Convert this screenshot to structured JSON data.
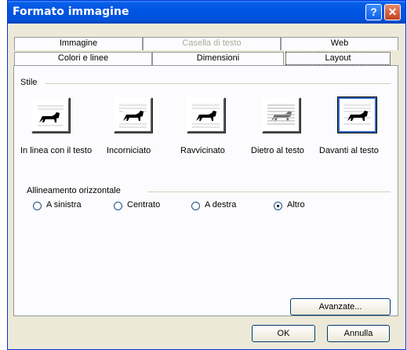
{
  "window": {
    "title": "Formato immagine"
  },
  "titlebar": {
    "help_glyph": "?",
    "close_glyph": "✕"
  },
  "tabs_row1": [
    {
      "label": "Immagine",
      "enabled": true
    },
    {
      "label": "Casella di testo",
      "enabled": false
    },
    {
      "label": "Web",
      "enabled": true
    }
  ],
  "tabs_row2": [
    {
      "label": "Colori e linee"
    },
    {
      "label": "Dimensioni"
    },
    {
      "label": "Layout",
      "active": true
    }
  ],
  "stile": {
    "label": "Stile",
    "options": [
      {
        "label": "In linea con il testo",
        "icon": "inline-dog-icon"
      },
      {
        "label": "Incorniciato",
        "icon": "square-dog-icon"
      },
      {
        "label": "Ravvicinato",
        "icon": "tight-dog-icon"
      },
      {
        "label": "Dietro al testo",
        "icon": "behind-text-dog-icon"
      },
      {
        "label": "Davanti al testo",
        "icon": "infront-text-dog-icon",
        "selected": true
      }
    ]
  },
  "allineamento": {
    "label": "Allineamento orizzontale",
    "options": [
      {
        "label": "A sinistra"
      },
      {
        "label": "Centrato"
      },
      {
        "label": "A destra"
      },
      {
        "label": "Altro",
        "selected": true
      }
    ]
  },
  "buttons": {
    "advanced": "Avanzate...",
    "ok": "OK",
    "cancel": "Annulla"
  },
  "colors": {
    "title_bar": "#0054e3",
    "selection": "#316ac5",
    "dialog_bg": "#ece9d8"
  }
}
